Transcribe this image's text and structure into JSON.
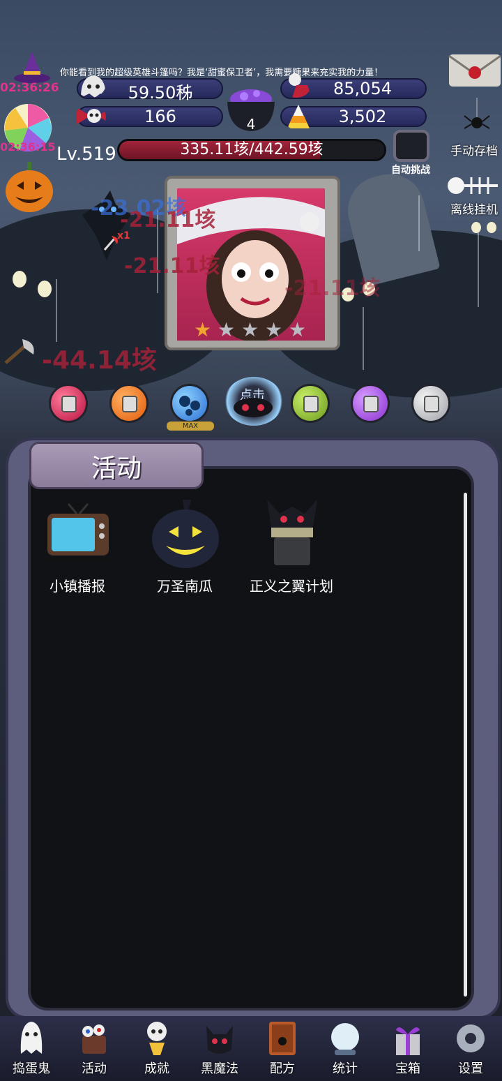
{
  "marquee": "你能看到我的超级英雄斗篷吗？我是‘甜蜜保卫者’，我需要糖果来充实我的力量！",
  "timers": [
    "02:36:26",
    "02:36:15"
  ],
  "resources": {
    "top_left": "59.50秭",
    "top_right": "85,054",
    "bottom_left": "166",
    "bottom_right": "3,502",
    "cauldron_count": "4"
  },
  "level": "Lv.519",
  "hp": {
    "text": "335.11垓/442.59垓",
    "fraction": 0.757
  },
  "auto_challenge_label": "自动挑战",
  "side_buttons": {
    "save": "手动存档",
    "offline": "离线挂机"
  },
  "damage_numbers": [
    "-23.02垓",
    "-21.11垓",
    "-21.11垓",
    "-21.11垓",
    "-44.14垓"
  ],
  "attack_badge": "x1",
  "stars": [
    "★",
    "★",
    "★",
    "★",
    "★"
  ],
  "star_filled": 1,
  "orb_max_label": "MAX",
  "click_label": "点击",
  "panel_title": "活动",
  "activities": [
    {
      "label": "小镇播报",
      "icon": "tv-icon"
    },
    {
      "label": "万圣南瓜",
      "icon": "pumpkin-icon"
    },
    {
      "label": "正义之翼计划",
      "icon": "bat-lantern-icon"
    }
  ],
  "nav": [
    {
      "label": "捣蛋鬼",
      "icon": "ghost-icon"
    },
    {
      "label": "活动",
      "icon": "eyeball-cake-icon"
    },
    {
      "label": "成就",
      "icon": "skull-trophy-icon"
    },
    {
      "label": "黑魔法",
      "icon": "black-cat-icon"
    },
    {
      "label": "配方",
      "icon": "spellbook-icon"
    },
    {
      "label": "统计",
      "icon": "crystal-ball-icon"
    },
    {
      "label": "宝箱",
      "icon": "gift-box-icon"
    },
    {
      "label": "设置",
      "icon": "gear-icon"
    }
  ],
  "colors": {
    "timer": "#e1338b",
    "damage": "#a52238",
    "hp_fill": "#a2243b",
    "panel": "#5d5e7e"
  }
}
